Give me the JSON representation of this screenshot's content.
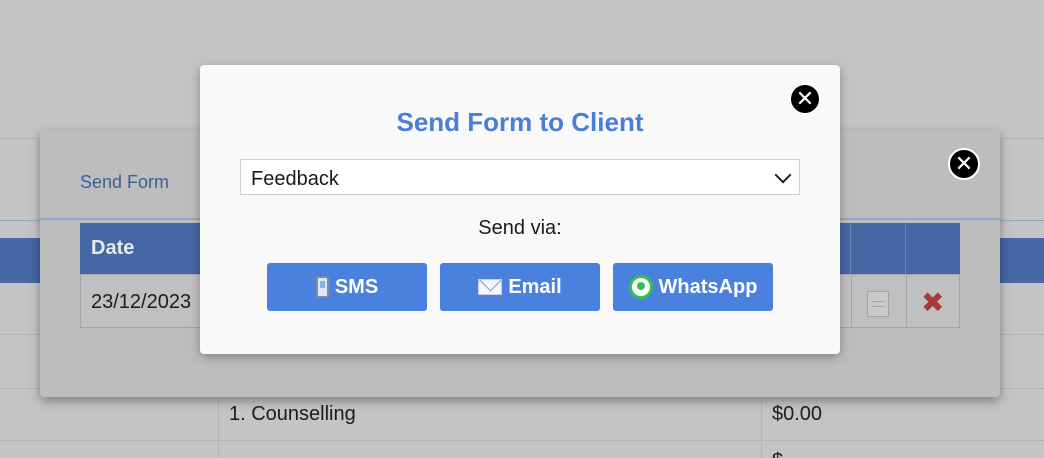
{
  "background": {
    "service_item": "1. Counselling",
    "service_price": "$0.00",
    "bottom_fragment": "$"
  },
  "back_modal": {
    "title": "Send Form",
    "table": {
      "header_date": "Date",
      "row_date": "23/12/2023"
    },
    "close_glyph": "✕",
    "delete_glyph": "✖"
  },
  "dialog": {
    "title": "Send Form to Client",
    "close_glyph": "✕",
    "form_select": {
      "selected": "Feedback"
    },
    "send_via_label": "Send via:",
    "buttons": {
      "sms": "SMS",
      "email": "Email",
      "whatsapp": "WhatsApp"
    }
  },
  "icons": {
    "sms": "mobile-phone-icon",
    "email": "envelope-icon",
    "whatsapp": "whatsapp-logo-icon",
    "document": "document-icon",
    "delete": "red-x-icon",
    "close": "close-icon"
  },
  "colors": {
    "accent_blue": "#4a80de",
    "title_blue": "#4a7fd6",
    "table_header": "#4567a3",
    "delete_red": "#a8383a",
    "whatsapp_green": "#2fc24d"
  }
}
